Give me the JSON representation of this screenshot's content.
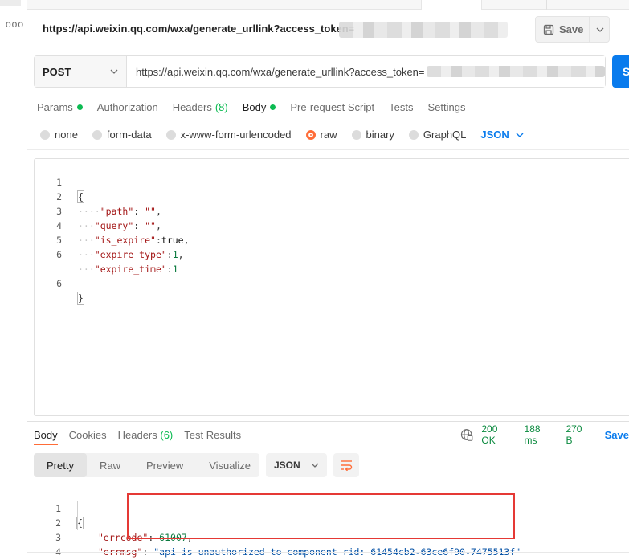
{
  "title_bar": {
    "url": "https://api.weixin.qq.com/wxa/generate_urllink?access_token=",
    "save_label": "Save"
  },
  "rail": {
    "more": "ooo"
  },
  "request": {
    "method": "POST",
    "url": "https://api.weixin.qq.com/wxa/generate_urllink?access_token=",
    "send_label": "S"
  },
  "request_tabs": [
    {
      "label": "Params",
      "dot": true
    },
    {
      "label": "Authorization"
    },
    {
      "label": "Headers",
      "count": "(8)"
    },
    {
      "label": "Body",
      "dot": true,
      "active": true
    },
    {
      "label": "Pre-request Script"
    },
    {
      "label": "Tests"
    },
    {
      "label": "Settings"
    }
  ],
  "body_types": [
    {
      "label": "none"
    },
    {
      "label": "form-data"
    },
    {
      "label": "x-www-form-urlencoded"
    },
    {
      "label": "raw",
      "checked": true
    },
    {
      "label": "binary"
    },
    {
      "label": "GraphQL"
    }
  ],
  "body_format": "JSON",
  "request_body": {
    "line_numbers": [
      "1",
      "2",
      "3",
      "4",
      "5",
      "6"
    ],
    "lines": [
      {
        "open": "{"
      },
      {
        "ws": "····",
        "key": "\"path\"",
        "sep": ": ",
        "val": "\"\"",
        "tail": ","
      },
      {
        "ws": "···",
        "key": "\"query\"",
        "sep": ": ",
        "val": "\"\"",
        "tail": ","
      },
      {
        "ws": "···",
        "key": "\"is_expire\"",
        "sep": ":",
        "val": "true",
        "tail": ","
      },
      {
        "ws": "···",
        "key": "\"expire_type\"",
        "sep": ":",
        "val": "1",
        "tail": ","
      },
      {
        "ws": "···",
        "key": "\"expire_time\"",
        "sep": ":",
        "val": "1",
        "tail": ""
      },
      {
        "close": "}"
      }
    ]
  },
  "response": {
    "tabs": [
      {
        "label": "Body",
        "active": true
      },
      {
        "label": "Cookies"
      },
      {
        "label": "Headers",
        "count": "(6)"
      },
      {
        "label": "Test Results"
      }
    ],
    "status": "200 OK",
    "time": "188 ms",
    "size": "270 B",
    "save_label": "Save",
    "view_modes": [
      "Pretty",
      "Raw",
      "Preview",
      "Visualize"
    ],
    "format": "JSON",
    "line_numbers": [
      "1",
      "2",
      "3",
      "4"
    ],
    "body": {
      "open": "{",
      "errcode_key": "\"errcode\"",
      "errcode_val": "61007",
      "errmsg_key": "\"errmsg\"",
      "errmsg_val": "\"api is unauthorized to component rid: 61454cb2-63ce6f90-7475513f\"",
      "close": "}"
    }
  },
  "colors": {
    "accent_blue": "#097bed",
    "accent_orange": "#ff6c37",
    "status_green": "#0cbb52",
    "highlight_red": "#e53935"
  }
}
